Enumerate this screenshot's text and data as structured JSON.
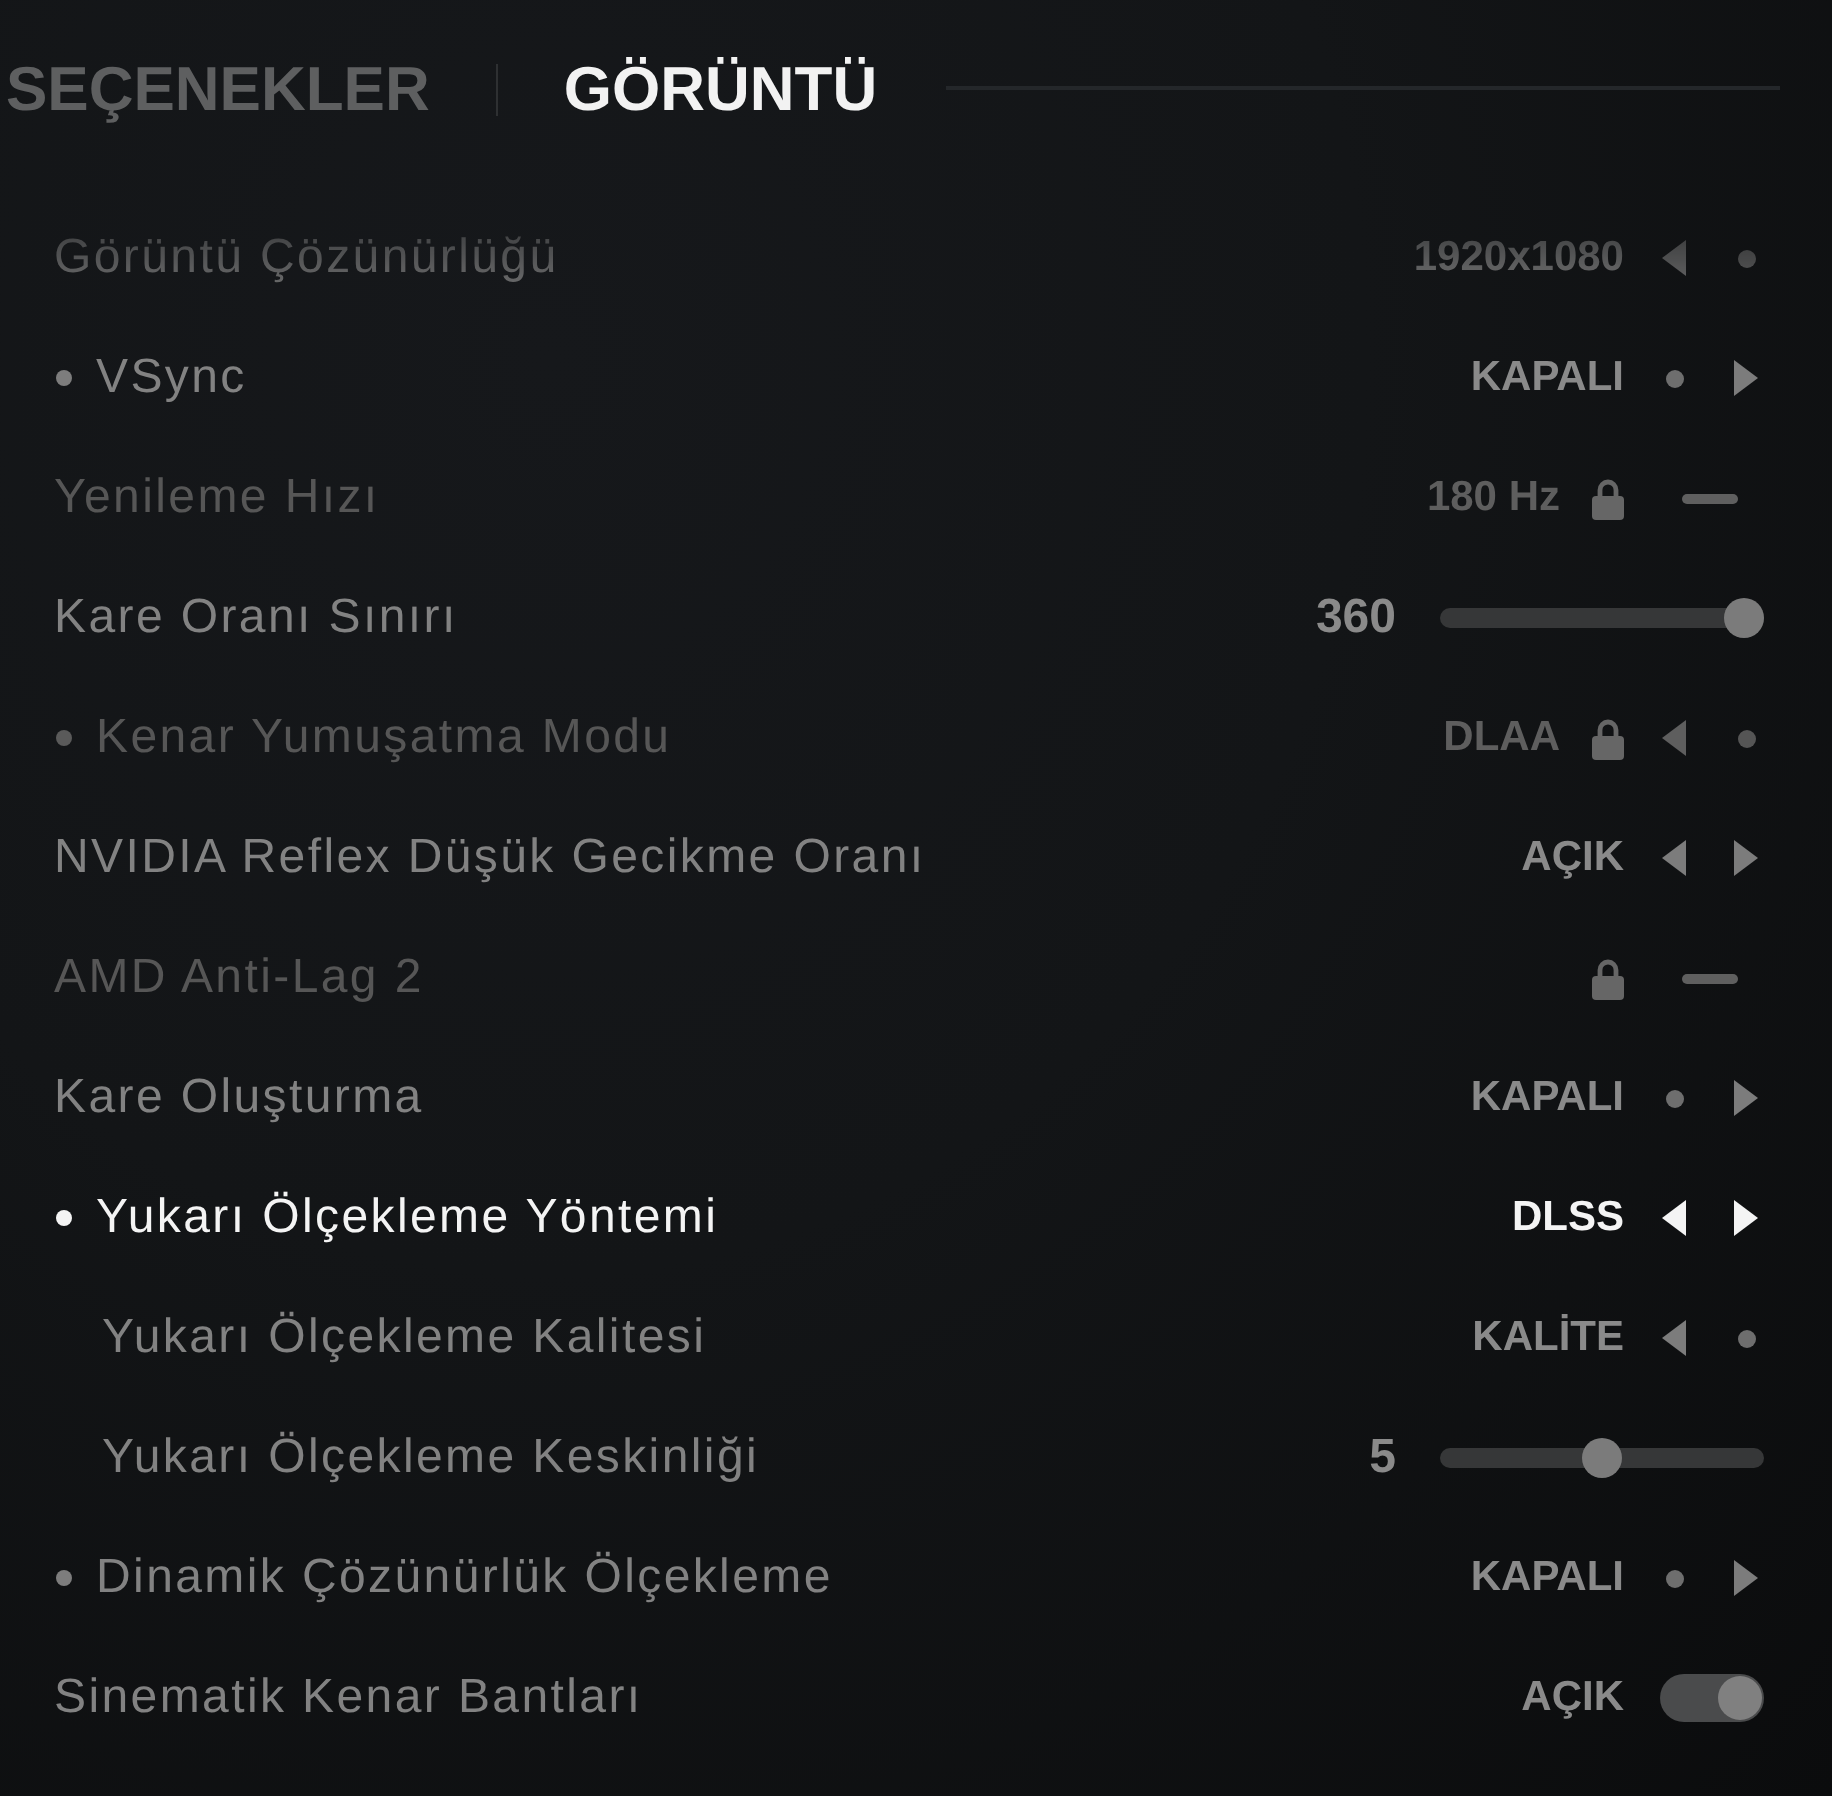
{
  "tabs": [
    {
      "label": "SEÇENEKLER",
      "selected": false
    },
    {
      "label": "GÖRÜNTÜ",
      "selected": true
    }
  ],
  "settings": [
    {
      "label": "Görüntü Çözünürlüğü",
      "selected": false,
      "marked": false,
      "disabled": false,
      "locked": false,
      "kind": "selector",
      "value": "1920x1080",
      "left_arrow": true,
      "right_arrow": false
    },
    {
      "label": "VSync",
      "selected": false,
      "marked": true,
      "disabled": false,
      "locked": false,
      "kind": "selector",
      "value": "KAPALI",
      "left_arrow": false,
      "right_arrow": true
    },
    {
      "label": "Yenileme Hızı",
      "selected": false,
      "marked": false,
      "disabled": true,
      "locked": true,
      "kind": "fixed",
      "value": "180 Hz"
    },
    {
      "label": "Kare Oranı Sınırı",
      "selected": false,
      "marked": false,
      "disabled": false,
      "locked": false,
      "kind": "slider",
      "value": "360",
      "level": 1
    },
    {
      "label": "Kenar Yumuşatma Modu",
      "selected": false,
      "marked": true,
      "disabled": true,
      "locked": true,
      "kind": "selector",
      "value": "DLAA",
      "left_arrow": true,
      "right_arrow": false
    },
    {
      "label": "NVIDIA Reflex Düşük Gecikme Oranı",
      "selected": false,
      "marked": false,
      "disabled": false,
      "locked": false,
      "kind": "selector",
      "value": "AÇIK",
      "left_arrow": true,
      "right_arrow": true
    },
    {
      "label": "AMD Anti-Lag 2",
      "selected": false,
      "marked": false,
      "disabled": true,
      "locked": true,
      "kind": "fixed"
    },
    {
      "label": "Kare Oluşturma",
      "selected": false,
      "marked": false,
      "disabled": false,
      "locked": false,
      "kind": "selector",
      "value": "KAPALI",
      "left_arrow": false,
      "right_arrow": true
    },
    {
      "label": "Yukarı Ölçekleme Yöntemi",
      "selected": true,
      "marked": true,
      "disabled": false,
      "locked": false,
      "kind": "selector",
      "value": "DLSS",
      "left_arrow": true,
      "right_arrow": true,
      "children": [
        {
          "label": "Yukarı Ölçekleme Kalitesi",
          "selected": false,
          "marked": false,
          "disabled": false,
          "locked": false,
          "kind": "selector",
          "value": "KALİTE",
          "left_arrow": true,
          "right_arrow": false
        },
        {
          "label": "Yukarı Ölçekleme Keskinliği",
          "selected": false,
          "marked": false,
          "disabled": false,
          "locked": false,
          "kind": "slider",
          "value": "5",
          "level": 0.5
        }
      ]
    },
    {
      "label": "Dinamik Çözünürlük Ölçekleme",
      "selected": false,
      "marked": true,
      "disabled": false,
      "locked": false,
      "kind": "selector",
      "value": "KAPALI",
      "left_arrow": false,
      "right_arrow": true
    },
    {
      "label": "Sinematik Kenar Bantları",
      "selected": false,
      "marked": false,
      "disabled": false,
      "locked": false,
      "kind": "toggle",
      "value": "AÇIK",
      "on": true
    }
  ]
}
